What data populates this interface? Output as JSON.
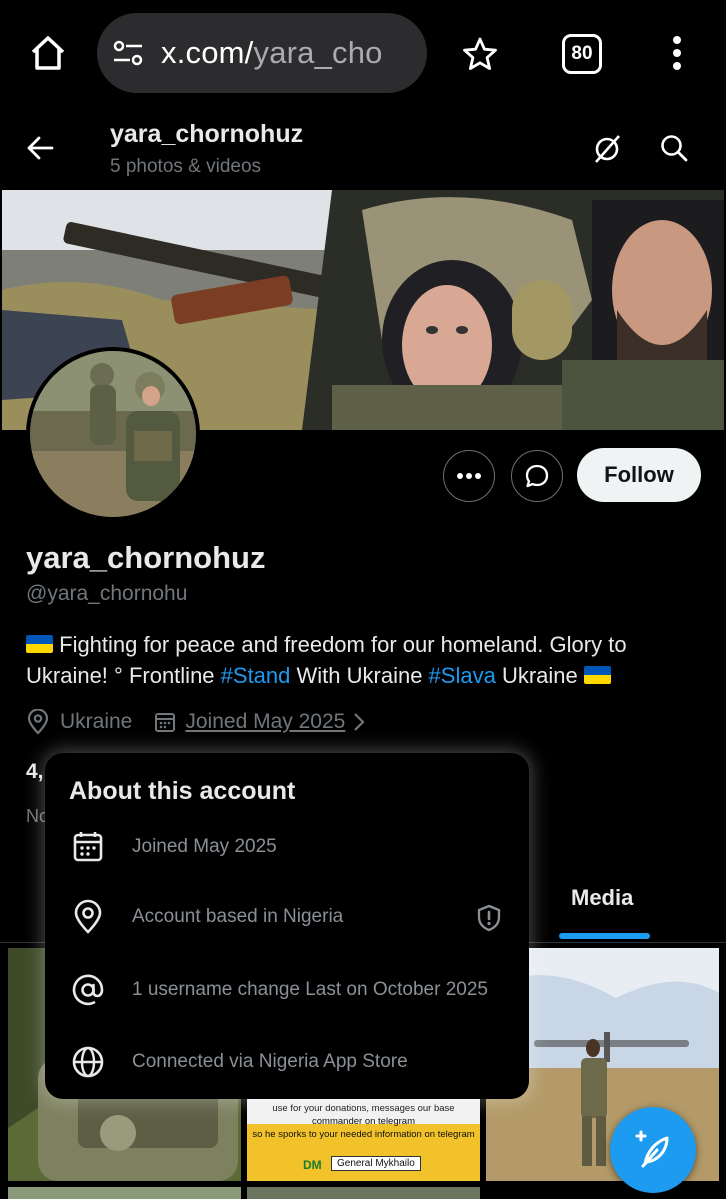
{
  "browser": {
    "url_domain": "x.com/",
    "url_path": "yara_cho",
    "tab_count": "80"
  },
  "header": {
    "title": "yara_chornohuz",
    "subtitle": "5 photos & videos"
  },
  "profile": {
    "display_name": "yara_chornohuz",
    "handle": "@yara_chornohu",
    "bio_line1": "Fighting for peace and freedom for our homeland. Glory to",
    "bio_line2_part1": "Ukraine! ° Frontline ",
    "bio_hashtag1": "#Stand",
    "bio_line2_part2": " With Ukraine ",
    "bio_hashtag2": "#Slava",
    "bio_line2_part3": " Ukraine ",
    "location": "Ukraine",
    "joined": "Joined May 2025",
    "stats_partial": "4,",
    "stats_row2_partial": "No",
    "follow_label": "Follow"
  },
  "tabs": {
    "active": "Media"
  },
  "about_popup": {
    "title": "About this account",
    "rows": [
      {
        "icon": "calendar-icon",
        "text": "Joined May 2025"
      },
      {
        "icon": "location-pin-icon",
        "text": "Account based in Nigeria"
      },
      {
        "icon": "at-sign-icon",
        "text": "1 username change Last on October 2025"
      },
      {
        "icon": "globe-icon",
        "text": "Connected via Nigeria App Store"
      }
    ]
  },
  "media_tiles": {
    "tile2_caption_lines": [
      "use for your donations, messages our base commander on telegram",
      "so he sporks to your needed information on telegram"
    ],
    "tile2_badge": "DM",
    "tile2_name": "General Mykhailo"
  },
  "colors": {
    "accent": "#1d9bf0",
    "background": "#000000",
    "follow_button": "#eff3f4"
  }
}
